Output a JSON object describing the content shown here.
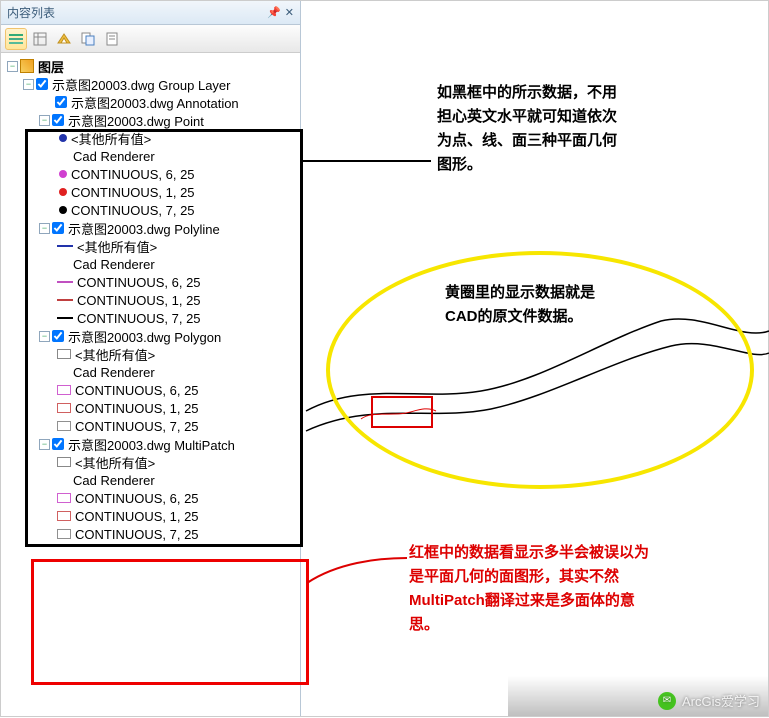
{
  "panel": {
    "title": "内容列表",
    "root_label": "图层",
    "group_layer": "示意图20003.dwg Group Layer",
    "annotation_layer": "示意图20003.dwg Annotation",
    "point_layer": "示意图20003.dwg Point",
    "polyline_layer": "示意图20003.dwg Polyline",
    "polygon_layer": "示意图20003.dwg Polygon",
    "multipatch_layer": "示意图20003.dwg MultiPatch",
    "other_values": "<其他所有值>",
    "cad_renderer": "Cad Renderer",
    "cont_6_25": "CONTINUOUS, 6, 25",
    "cont_1_25": "CONTINUOUS, 1, 25",
    "cont_7_25": "CONTINUOUS, 7, 25"
  },
  "annotations": {
    "black": "如黑框中的所示数据，不用担心英文水平就可知道依次为点、线、面三种平面几何图形。",
    "yellow": "黄圈里的显示数据就是CAD的原文件数据。",
    "red": "红框中的数据看显示多半会被误以为是平面几何的面图形，其实不然MultiPatch翻译过来是多面体的意思。"
  },
  "watermark": {
    "label": "ArcGis爱学习"
  },
  "icons": {
    "pin": "pin-icon",
    "close": "close-icon",
    "list": "list-icon",
    "source": "source-icon",
    "visible": "visible-icon",
    "select": "select-icon"
  },
  "colors": {
    "point_other": "#2233aa",
    "point_6": "#d040d0",
    "point_1": "#e02020",
    "point_7": "#000000",
    "line_other": "#2233aa",
    "line_6": "#c050c0",
    "line_1": "#c04040",
    "line_7": "#000000",
    "poly_6": "#d060d0",
    "poly_1": "#d06060",
    "poly_7": "#909090"
  }
}
